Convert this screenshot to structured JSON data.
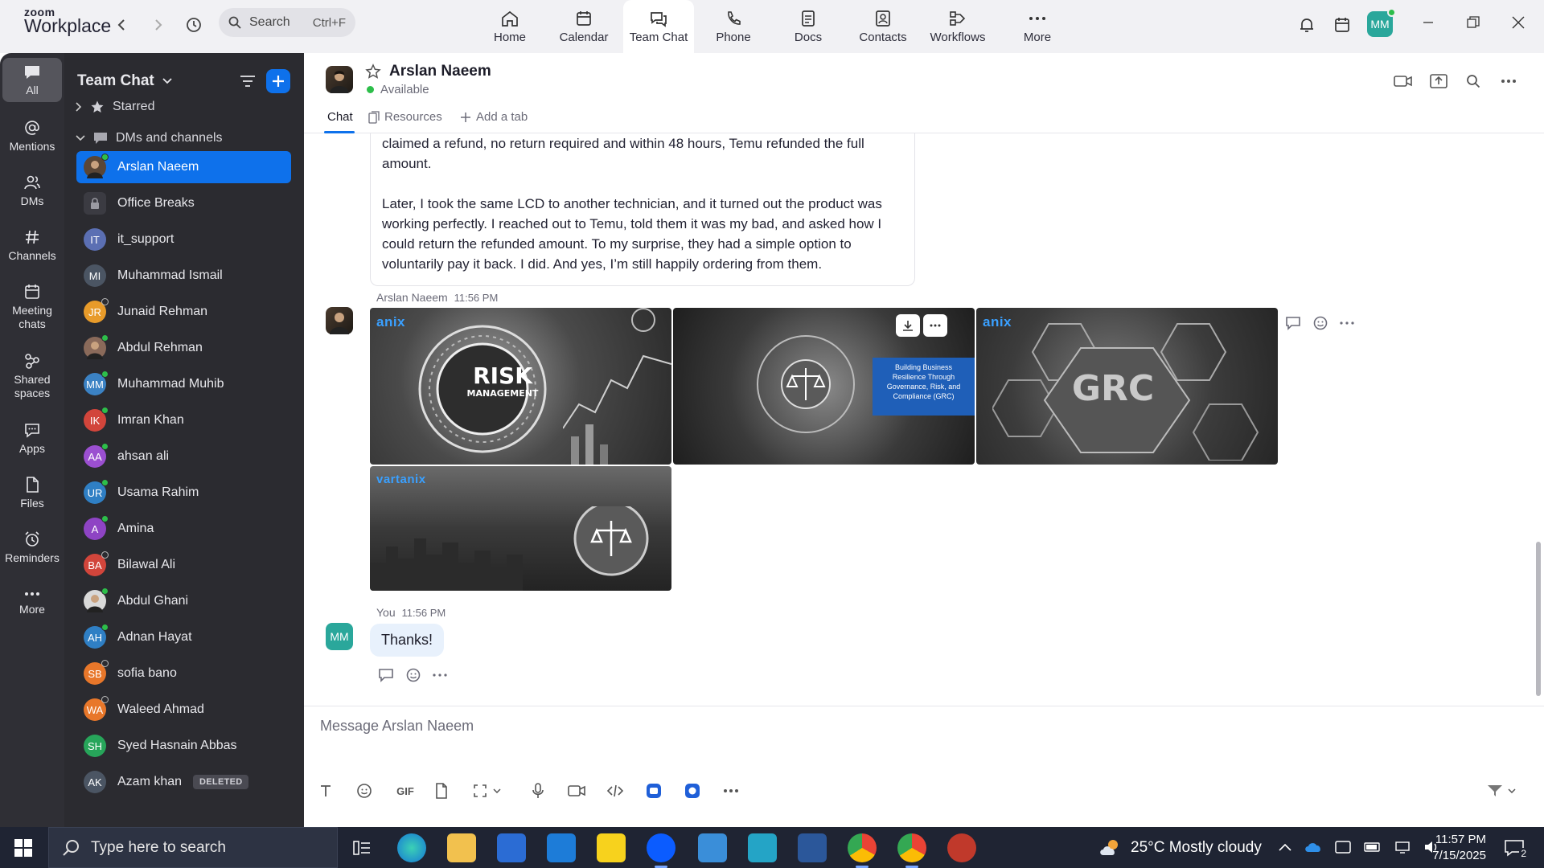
{
  "app": {
    "logo_line1": "zoom",
    "logo_line2": "Workplace"
  },
  "search": {
    "placeholder": "Search",
    "shortcut": "Ctrl+F"
  },
  "nav_tabs": [
    {
      "label": "Home",
      "icon": "home-icon"
    },
    {
      "label": "Calendar",
      "icon": "calendar-icon"
    },
    {
      "label": "Team Chat",
      "icon": "chat-icon",
      "active": true
    },
    {
      "label": "Phone",
      "icon": "phone-icon"
    },
    {
      "label": "Docs",
      "icon": "docs-icon"
    },
    {
      "label": "Contacts",
      "icon": "contacts-icon"
    },
    {
      "label": "Workflows",
      "icon": "workflows-icon"
    },
    {
      "label": "More",
      "icon": "more-icon"
    }
  ],
  "user_avatar_initials": "MM",
  "rail": [
    {
      "label": "All",
      "icon": "chat-bubble-icon",
      "active": true
    },
    {
      "label": "Mentions",
      "icon": "at-icon"
    },
    {
      "label": "DMs",
      "icon": "people-icon"
    },
    {
      "label": "Channels",
      "icon": "hash-icon"
    },
    {
      "label": "Meeting chats",
      "icon": "meeting-calendar-icon"
    },
    {
      "label": "Shared spaces",
      "icon": "shared-spaces-icon"
    },
    {
      "label": "Apps",
      "icon": "apps-icon"
    },
    {
      "label": "Files",
      "icon": "file-icon"
    },
    {
      "label": "Reminders",
      "icon": "alarm-icon"
    },
    {
      "label": "More",
      "icon": "more-icon"
    }
  ],
  "sidebar": {
    "title": "Team Chat",
    "sections": {
      "starred": "Starred",
      "dms": "DMs and channels"
    },
    "contacts": [
      {
        "name": "Arslan Naeem",
        "initials": "",
        "color": "#5a4636",
        "status": "on",
        "selected": true
      },
      {
        "name": "Office Breaks",
        "initials": "",
        "color": "#3b3b42",
        "status": "none",
        "lock": true
      },
      {
        "name": "it_support",
        "initials": "IT",
        "color": "#5b6fb3",
        "status": "none"
      },
      {
        "name": "Muhammad Ismail",
        "initials": "MI",
        "color": "#4b5563",
        "status": "none"
      },
      {
        "name": "Junaid Rehman",
        "initials": "JR",
        "color": "#e89b2a",
        "status": "off"
      },
      {
        "name": "Abdul Rehman",
        "initials": "",
        "color": "#8a6a5a",
        "status": "on"
      },
      {
        "name": "Muhammad Muhib",
        "initials": "MM",
        "color": "#3b82c4",
        "status": "on"
      },
      {
        "name": "Imran Khan",
        "initials": "IK",
        "color": "#d2453b",
        "status": "on"
      },
      {
        "name": "ahsan ali",
        "initials": "AA",
        "color": "#9b4fd0",
        "status": "on"
      },
      {
        "name": "Usama Rahim",
        "initials": "UR",
        "color": "#2f7fc4",
        "status": "on"
      },
      {
        "name": "Amina",
        "initials": "A",
        "color": "#8e44c4",
        "status": "on"
      },
      {
        "name": "Bilawal Ali",
        "initials": "BA",
        "color": "#d2453b",
        "status": "off"
      },
      {
        "name": "Abdul Ghani",
        "initials": "",
        "color": "#d9d9d9",
        "status": "on"
      },
      {
        "name": "Adnan Hayat",
        "initials": "AH",
        "color": "#2f7fc4",
        "status": "on"
      },
      {
        "name": "sofia bano",
        "initials": "SB",
        "color": "#e8772a",
        "status": "off"
      },
      {
        "name": "Waleed Ahmad",
        "initials": "WA",
        "color": "#e8772a",
        "status": "off"
      },
      {
        "name": "Syed Hasnain Abbas",
        "initials": "SH",
        "color": "#27a55a",
        "status": "none"
      },
      {
        "name": "Azam khan",
        "initials": "AK",
        "color": "#4b5563",
        "status": "none",
        "badge": "DELETED"
      }
    ]
  },
  "channel": {
    "name": "Arslan Naeem",
    "status": "Available",
    "tabs": {
      "chat": "Chat",
      "resources": "Resources",
      "add": "Add a tab"
    }
  },
  "messages": {
    "quote_paragraph1": "claimed a refund, no return required and within 48 hours, Temu refunded the full amount.",
    "quote_paragraph2": "Later, I took the same LCD to another technician, and it turned out the product was working perfectly. I reached out to Temu, told them it was my bad, and asked how I could return the refunded amount. To my surprise, they had a simple option to voluntarily pay it back. I did. And yes, I’m still happily ordering from them.",
    "image_msg": {
      "sender": "Arslan Naeem",
      "time": "11:56 PM"
    },
    "images": {
      "img1_brand": "anix",
      "img1_text_1": "RISK",
      "img1_text_2": "MANAGEMENT",
      "img2_caption": "Building Business Resilience Through Governance, Risk, and Compliance (GRC)",
      "img3_brand": "anix",
      "img3_text": "GRC",
      "img4_brand": "vartanix"
    },
    "own_msg": {
      "sender": "You",
      "time": "11:56 PM",
      "text": "Thanks!",
      "initials": "MM"
    }
  },
  "composer": {
    "placeholder": "Message Arslan Naeem",
    "gif_label": "GIF"
  },
  "taskbar": {
    "search_placeholder": "Type here to search",
    "weather": "25°C  Mostly cloudy",
    "time": "11:57 PM",
    "date": "7/15/2025",
    "notifications": "2"
  }
}
